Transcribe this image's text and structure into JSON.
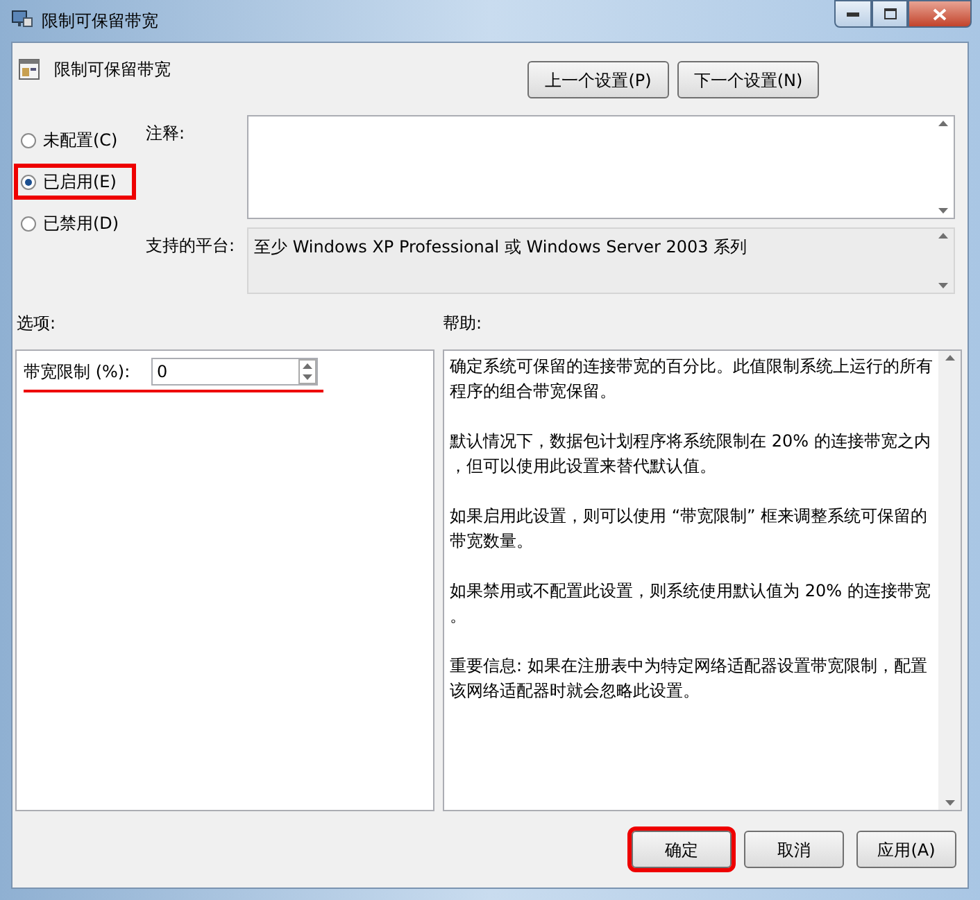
{
  "window": {
    "title": "限制可保留带宽"
  },
  "header": {
    "title": "限制可保留带宽"
  },
  "nav_buttons": [
    {
      "label": "上一个设置(P)"
    },
    {
      "label": "下一个设置(N)"
    }
  ],
  "state_options": [
    {
      "label": "未配置(C)",
      "selected": false,
      "highlighted": false
    },
    {
      "label": "已启用(E)",
      "selected": true,
      "highlighted": true
    },
    {
      "label": "已禁用(D)",
      "selected": false,
      "highlighted": false
    }
  ],
  "comment": {
    "label": "注释:"
  },
  "platform": {
    "label": "支持的平台:",
    "value": "至少 Windows XP Professional 或 Windows Server 2003 系列"
  },
  "options": {
    "label": "选项:",
    "fields": [
      {
        "label": "带宽限制 (%):",
        "value": "0",
        "highlighted": true
      }
    ]
  },
  "help": {
    "label": "帮助:",
    "paragraphs": [
      [
        "确定系统可保留的连接带宽的百分比。此值限制系统上运行的所有",
        "程序的组合带宽保留。"
      ],
      [
        "默认情况下，数据包计划程序将系统限制在 20% 的连接带宽之内",
        "，但可以使用此设置来替代默认值。"
      ],
      [
        "如果启用此设置，则可以使用 “带宽限制” 框来调整系统可保留的",
        "带宽数量。"
      ],
      [
        "如果禁用或不配置此设置，则系统使用默认值为 20% 的连接带宽",
        "。"
      ],
      [
        "重要信息: 如果在注册表中为特定网络适配器设置带宽限制，配置",
        "该网络适配器时就会忽略此设置。"
      ]
    ]
  },
  "buttons": [
    {
      "label": "确定",
      "highlighted": true
    },
    {
      "label": "取消",
      "highlighted": false
    },
    {
      "label": "应用(A)",
      "highlighted": false
    }
  ]
}
